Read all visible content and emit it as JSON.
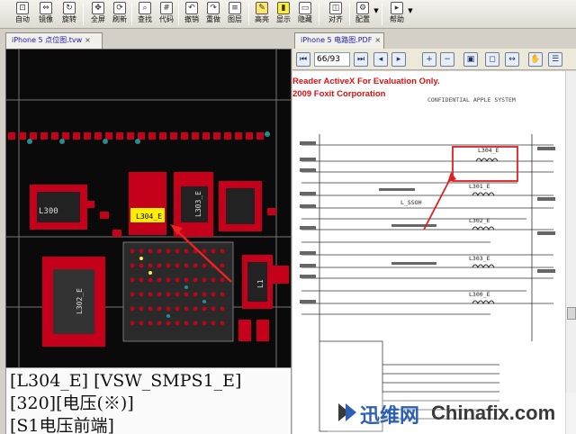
{
  "toolbar": {
    "buttons": [
      {
        "label": "自动",
        "icon": "fit-icon"
      },
      {
        "label": "镜像",
        "icon": "mirror-icon"
      },
      {
        "label": "旋转",
        "icon": "rotate-icon"
      },
      {
        "label": "全屏",
        "icon": "fullscreen-icon"
      },
      {
        "label": "刷新",
        "icon": "refresh-icon"
      },
      {
        "label": "查找",
        "icon": "search-icon"
      },
      {
        "label": "代码",
        "icon": "code-icon"
      },
      {
        "label": "撤销",
        "icon": "undo-icon"
      },
      {
        "label": "重做",
        "icon": "redo-icon"
      },
      {
        "label": "图层",
        "icon": "layer-icon"
      },
      {
        "label": "高亮",
        "icon": "highlight-icon"
      },
      {
        "label": "显示",
        "icon": "show-icon"
      },
      {
        "label": "隐藏",
        "icon": "hide-icon"
      },
      {
        "label": "对齐",
        "icon": "align-icon"
      },
      {
        "label": "配置",
        "icon": "settings-icon"
      },
      {
        "label": "帮助",
        "icon": "help-icon"
      }
    ]
  },
  "left_panel": {
    "tab_label": "iPhone 5 点位图.tvw",
    "info_lines": [
      "[L304_E] [VSW_SMPS1_E]",
      "[320][电压(※)]",
      "[S1电压前端]"
    ],
    "components": {
      "highlighted": "L304_E",
      "others": [
        "L300",
        "L302_E",
        "L303_E",
        "L301_E",
        "L1"
      ]
    },
    "highlight_color": "#ffee00",
    "board_color": "#0a0a0a"
  },
  "right_panel": {
    "tab_label": "iPhone 5 电路图.PDF",
    "page_value": "66/93",
    "eval_lines": [
      "Reader ActiveX For Evaluation Only.",
      "2009 Foxit Corporation"
    ],
    "schematic_title": "CONFIDENTIAL APPLE SYSTEM",
    "schematic_labels": [
      "L304_E",
      "L301_E",
      "L302_E",
      "L303_E",
      "L300_E",
      "L_SSOH"
    ],
    "annotation_color": "#e02020"
  },
  "watermark": {
    "cn_text": "迅维网",
    "en_text": "Chinafix.com"
  }
}
